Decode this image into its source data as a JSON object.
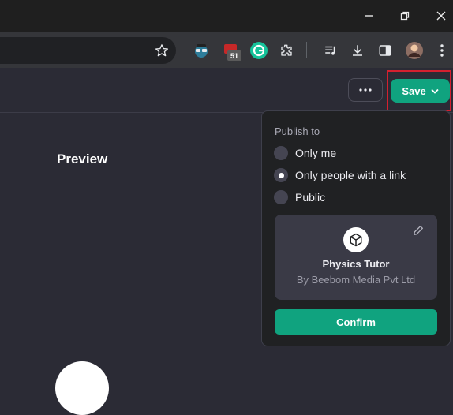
{
  "browser": {
    "extension_badge_count": "51"
  },
  "header": {
    "save_label": "Save"
  },
  "main": {
    "preview_title": "Preview"
  },
  "publish_menu": {
    "heading": "Publish to",
    "options": [
      {
        "label": "Only me",
        "selected": false
      },
      {
        "label": "Only people with a link",
        "selected": true
      },
      {
        "label": "Public",
        "selected": false
      }
    ],
    "card": {
      "name": "Physics Tutor",
      "author": "By Beebom Media Pvt Ltd"
    },
    "confirm_label": "Confirm"
  },
  "colors": {
    "accent": "#10a37f",
    "highlight": "#d3202f",
    "background": "#2b2b35",
    "menu_background": "#202123"
  },
  "icons": {
    "window": [
      "minimize-icon",
      "restore-icon",
      "close-icon"
    ],
    "toolbar": [
      "star-icon",
      "extension-icon",
      "grammarly-icon",
      "puzzle-icon",
      "media-icon",
      "download-icon",
      "sidepanel-icon",
      "profile-avatar",
      "kebab-menu-icon"
    ]
  }
}
